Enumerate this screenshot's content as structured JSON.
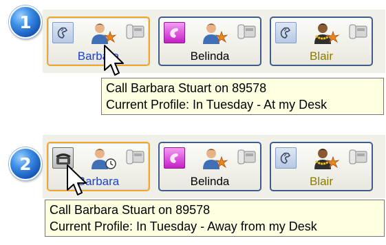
{
  "steps": [
    {
      "number": "1",
      "contacts": [
        {
          "name": "Barbara",
          "name_color": "#1a3fd6",
          "phone_state": "handset-icon",
          "presence": "busy-star",
          "selected": true
        },
        {
          "name": "Belinda",
          "name_color": "#000000",
          "phone_state": "magenta-handset-icon",
          "presence": "busy-star",
          "selected": false
        },
        {
          "name": "Blair",
          "name_color": "#8a7a00",
          "phone_state": "handset-icon",
          "presence": "busy-star-lei",
          "selected": false
        }
      ],
      "tooltip": {
        "line1": "Call Barbara Stuart on 89578",
        "line2": "Current Profile: In Tuesday - At my Desk"
      }
    },
    {
      "number": "2",
      "contacts": [
        {
          "name": "Barbara",
          "name_color": "#1a3fd6",
          "phone_state": "desk-phone-icon",
          "presence": "away-clock",
          "selected": true
        },
        {
          "name": "Belinda",
          "name_color": "#000000",
          "phone_state": "magenta-handset-icon",
          "presence": "busy-star",
          "selected": false
        },
        {
          "name": "Blair",
          "name_color": "#8a7a00",
          "phone_state": "handset-icon",
          "presence": "busy-star-lei",
          "selected": false
        }
      ],
      "tooltip": {
        "line1": "Call Barbara Stuart on 89578",
        "line2": "Current Profile: In Tuesday - Away from my Desk"
      }
    }
  ],
  "colors": {
    "accent_selected": "#f5a623",
    "button_border": "#3d5c8c",
    "panel_bg": "#f0efe8",
    "tooltip_bg": "#ffffe1",
    "badge_blue": "#1556b8"
  }
}
